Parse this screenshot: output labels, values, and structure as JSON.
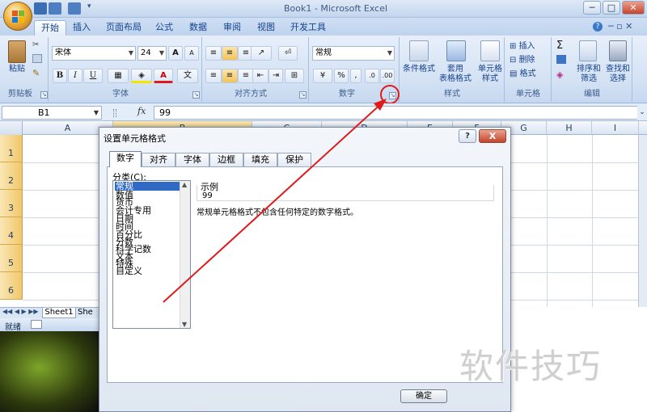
{
  "window": {
    "title": "Book1 - Microsoft Excel"
  },
  "tabs": [
    {
      "label": "开始",
      "active": true
    },
    {
      "label": "插入"
    },
    {
      "label": "页面布局"
    },
    {
      "label": "公式"
    },
    {
      "label": "数据"
    },
    {
      "label": "审阅"
    },
    {
      "label": "视图"
    },
    {
      "label": "开发工具"
    }
  ],
  "ribbon": {
    "clipboard": {
      "paste": "粘贴",
      "label": "剪贴板"
    },
    "font": {
      "name": "宋体",
      "size": "24",
      "bold": "B",
      "italic": "I",
      "underline": "U",
      "label": "字体",
      "grow": "A",
      "shrink": "A",
      "font_color_letter": "A"
    },
    "alignment": {
      "label": "对齐方式"
    },
    "number": {
      "format": "常规",
      "percent": "%",
      "comma": ",",
      "label": "数字"
    },
    "styles": {
      "conditional": "条件格式",
      "table": "套用",
      "table2": "表格格式",
      "cell": "单元格",
      "cell2": "样式",
      "label": "样式"
    },
    "cells": {
      "insert": "插入",
      "delete": "删除",
      "format": "格式",
      "label": "单元格"
    },
    "editing": {
      "sigma": "Σ",
      "sort": "排序和",
      "sort2": "筛选",
      "find": "查找和",
      "find2": "选择",
      "label": "编辑"
    }
  },
  "formula_bar": {
    "name_box": "B1",
    "fx": "fx",
    "content": "99"
  },
  "grid": {
    "columns": [
      "A",
      "B",
      "C",
      "D",
      "E",
      "F",
      "G",
      "H",
      "I"
    ],
    "rows": [
      "1",
      "2",
      "3",
      "4",
      "5",
      "6"
    ],
    "selected_column": "B"
  },
  "sheet": {
    "tab1": "Sheet1",
    "tab2": "She",
    "status": "就绪"
  },
  "dialog": {
    "title": "设置单元格格式",
    "help": "?",
    "close": "X",
    "tabs": [
      "数字",
      "对齐",
      "字体",
      "边框",
      "填充",
      "保护"
    ],
    "category_label": "分类(C):",
    "categories": [
      "常规",
      "数值",
      "货币",
      "会计专用",
      "日期",
      "时间",
      "百分比",
      "分数",
      "科学记数",
      "文本",
      "特殊",
      "自定义"
    ],
    "selected_category": "常规",
    "sample_label": "示例",
    "sample_value": "99",
    "description": "常规单元格格式不包含任何特定的数字格式。",
    "ok": "确定"
  },
  "watermark": "软件技巧",
  "colors": {
    "accent": "#e01a1a",
    "ribbon": "#dbe7f6",
    "selected": "#316ac5"
  }
}
